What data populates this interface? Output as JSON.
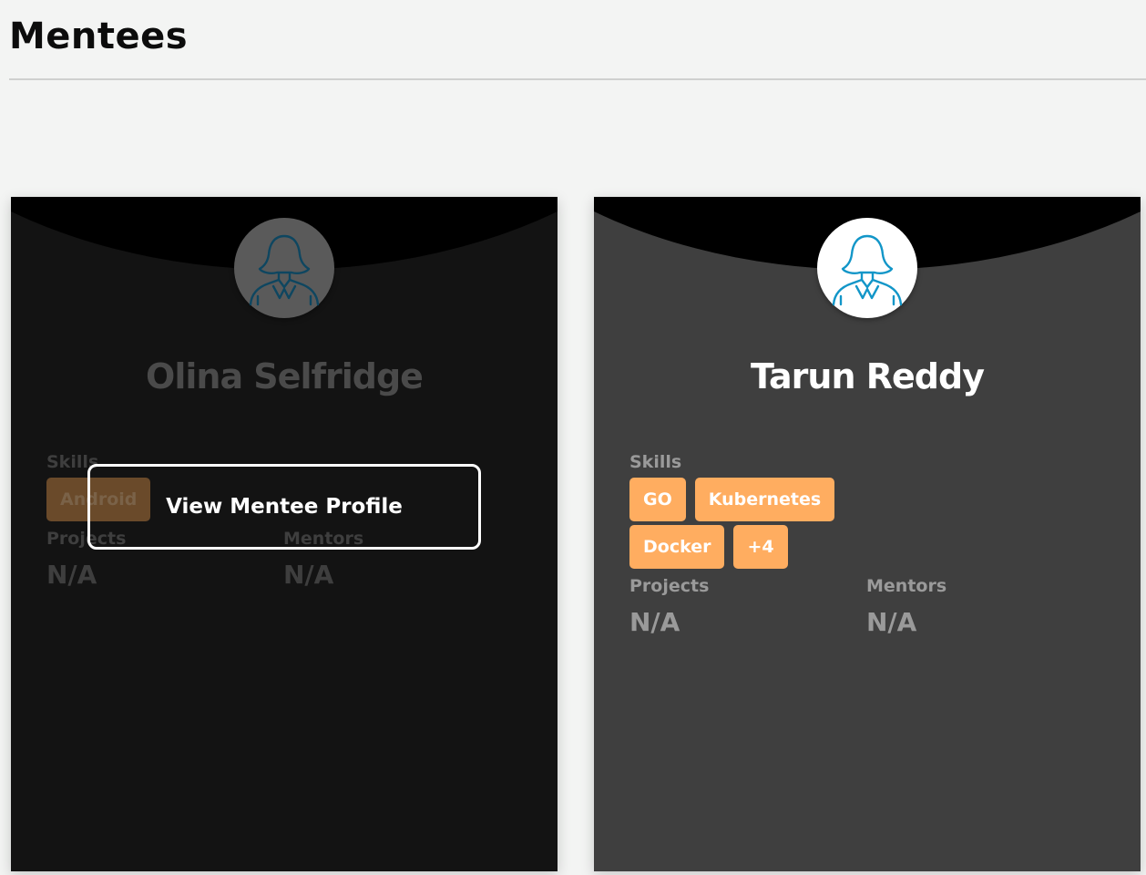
{
  "header": {
    "title": "Mentees"
  },
  "mentees": [
    {
      "name": "Olina Selfridge",
      "skills_label": "Skills",
      "skills": [
        "Android"
      ],
      "projects_label": "Projects",
      "projects_value": "N/A",
      "mentors_label": "Mentors",
      "mentors_value": "N/A",
      "view_profile_label": "View Mentee Profile"
    },
    {
      "name": "Tarun Reddy",
      "skills_label": "Skills",
      "skills": [
        "GO",
        "Kubernetes",
        "Docker",
        "+4"
      ],
      "projects_label": "Projects",
      "projects_value": "N/A",
      "mentors_label": "Mentors",
      "mentors_value": "N/A"
    }
  ],
  "icons": {
    "avatar": "user-avatar-icon"
  },
  "colors": {
    "page_background": "#f3f4f3",
    "card_hovered": "#131313",
    "card": "#3f3f3f",
    "skill_chip": "#ffad60",
    "avatar_stroke": "#1296c8"
  }
}
